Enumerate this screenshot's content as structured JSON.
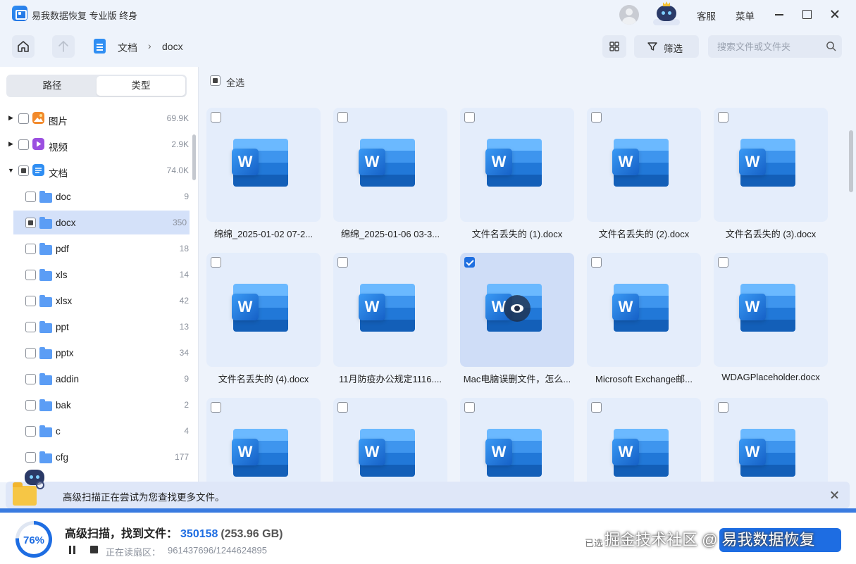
{
  "app": {
    "title": "易我数据恢复 专业版 终身"
  },
  "titlebar": {
    "service": "客服",
    "menu": "菜单"
  },
  "breadcrumb": {
    "level1": "文档",
    "separator": "›",
    "level2": "docx"
  },
  "toolbar": {
    "filter_label": "筛选"
  },
  "search": {
    "placeholder": "搜索文件或文件夹",
    "value": ""
  },
  "left": {
    "tabs": [
      {
        "label": "路径",
        "active": false
      },
      {
        "label": "类型",
        "active": true
      }
    ],
    "categories": [
      {
        "label": "图片",
        "count": "69.9K",
        "icon": "image-icon",
        "color": "#f28a2c"
      },
      {
        "label": "视频",
        "count": "2.9K",
        "icon": "video-icon",
        "color": "#9b4fe0"
      },
      {
        "label": "文档",
        "count": "74.0K",
        "icon": "document-icon",
        "color": "#2f8ef3"
      }
    ],
    "subfolders": [
      {
        "label": "doc",
        "count": "9"
      },
      {
        "label": "docx",
        "count": "350"
      },
      {
        "label": "pdf",
        "count": "18"
      },
      {
        "label": "xls",
        "count": "14"
      },
      {
        "label": "xlsx",
        "count": "42"
      },
      {
        "label": "ppt",
        "count": "13"
      },
      {
        "label": "pptx",
        "count": "34"
      },
      {
        "label": "addin",
        "count": "9"
      },
      {
        "label": "bak",
        "count": "2"
      },
      {
        "label": "c",
        "count": "4"
      },
      {
        "label": "cfg",
        "count": "177"
      }
    ]
  },
  "main": {
    "select_all_label": "全选",
    "files": [
      {
        "name": "绵绵_2025-01-02 07-2..."
      },
      {
        "name": "绵绵_2025-01-06 03-3..."
      },
      {
        "name": "文件名丢失的 (1).docx"
      },
      {
        "name": "文件名丢失的 (2).docx"
      },
      {
        "name": "文件名丢失的 (3).docx"
      },
      {
        "name": "文件名丢失的 (4).docx"
      },
      {
        "name": "11月防疫办公规定1116...."
      },
      {
        "name": "Mac电脑误删文件，怎么..."
      },
      {
        "name": "Microsoft Exchange邮..."
      },
      {
        "name": "WDAGPlaceholder.docx"
      },
      {
        "name": ""
      },
      {
        "name": ""
      },
      {
        "name": ""
      },
      {
        "name": ""
      },
      {
        "name": ""
      }
    ],
    "word_glyph": "W"
  },
  "notification": {
    "text": "高级扫描正在尝试为您查找更多文件。"
  },
  "status": {
    "progress_percent": 76,
    "progress_label": "76%",
    "scan_title": "高级扫描，找到文件：",
    "file_count": "350158",
    "size": "(253.96 GB)",
    "sector_label": "正在读扇区：",
    "sector_value": "961437696/1244624895",
    "selected_label": "已选"
  },
  "watermark": "掘金技术社区 @ 易我数据恢复",
  "colors": {
    "accent": "#1e6de2",
    "panel_bg": "#eef3fb",
    "tile_bg": "#e4edfb"
  }
}
